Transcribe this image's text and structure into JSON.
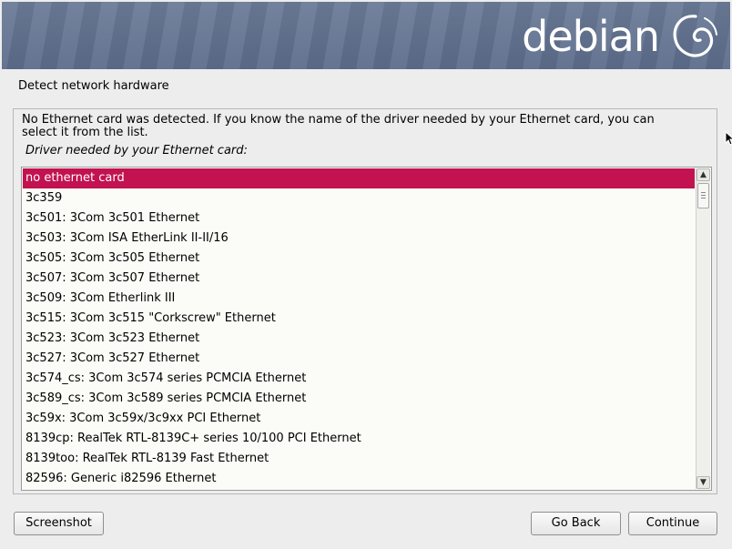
{
  "banner": {
    "logo_text": "debian",
    "logo_swirl_icon": "debian-swirl-icon"
  },
  "page": {
    "title": "Detect network hardware"
  },
  "panel": {
    "message": "No Ethernet card was detected. If you know the name of the driver needed by your Ethernet card, you can select it from the list.",
    "question": "Driver needed by your Ethernet card:"
  },
  "driver_list": {
    "selected_index": 0,
    "items": [
      "no ethernet card",
      "3c359",
      "3c501: 3Com 3c501 Ethernet",
      "3c503: 3Com ISA EtherLink II-II/16",
      "3c505: 3Com 3c505 Ethernet",
      "3c507: 3Com 3c507 Ethernet",
      "3c509: 3Com Etherlink III",
      "3c515: 3Com 3c515 \"Corkscrew\" Ethernet",
      "3c523: 3Com 3c523 Ethernet",
      "3c527: 3Com 3c527 Ethernet",
      "3c574_cs: 3Com 3c574 series PCMCIA Ethernet",
      "3c589_cs: 3Com 3c589 series PCMCIA Ethernet",
      "3c59x: 3Com 3c59x/3c9xx PCI Ethernet",
      "8139cp: RealTek RTL-8139C+ series 10/100 PCI Ethernet",
      "8139too: RealTek RTL-8139 Fast Ethernet",
      "82596: Generic i82596 Ethernet"
    ]
  },
  "buttons": {
    "screenshot": "Screenshot",
    "go_back": "Go Back",
    "continue": "Continue"
  },
  "colors": {
    "selection": "#c2124f",
    "banner": "#5d6d8b",
    "background": "#ededed"
  }
}
